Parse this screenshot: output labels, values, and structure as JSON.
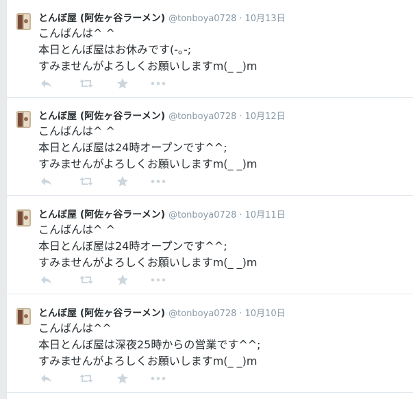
{
  "tweets": [
    {
      "fullname": "とんぼ屋 (阿佐ヶ谷ラーメン)",
      "username": "@tonboya0728",
      "separator": "·",
      "date": "10月13日",
      "lines": [
        "こんばんは^ ^",
        "本日とんぼ屋はお休みです(-｡-;",
        "すみませんがよろしくお願いしますm(_ _)m"
      ]
    },
    {
      "fullname": "とんぼ屋 (阿佐ヶ谷ラーメン)",
      "username": "@tonboya0728",
      "separator": "·",
      "date": "10月12日",
      "lines": [
        "こんばんは^ ^",
        "本日とんぼ屋は24時オープンです^^;",
        "すみませんがよろしくお願いしますm(_ _)m"
      ]
    },
    {
      "fullname": "とんぼ屋 (阿佐ヶ谷ラーメン)",
      "username": "@tonboya0728",
      "separator": "·",
      "date": "10月11日",
      "lines": [
        "こんばんは^ ^",
        "本日とんぼ屋は24時オープンです^^;",
        "すみませんがよろしくお願いしますm(_ _)m"
      ]
    },
    {
      "fullname": "とんぼ屋 (阿佐ヶ谷ラーメン)",
      "username": "@tonboya0728",
      "separator": "·",
      "date": "10月10日",
      "lines": [
        "こんばんは^^",
        "本日とんぼ屋は深夜25時からの営業です^^;",
        "すみませんがよろしくお願いしますm(_ _)m"
      ]
    }
  ],
  "actions": [
    "reply-icon",
    "retweet-icon",
    "favorite-icon",
    "more-icon"
  ],
  "colors": {
    "text": "#292f33",
    "meta": "#8899a6",
    "icon": "#ccd6dd",
    "divider": "#e1e8ed",
    "background": "#e9eaeb"
  }
}
